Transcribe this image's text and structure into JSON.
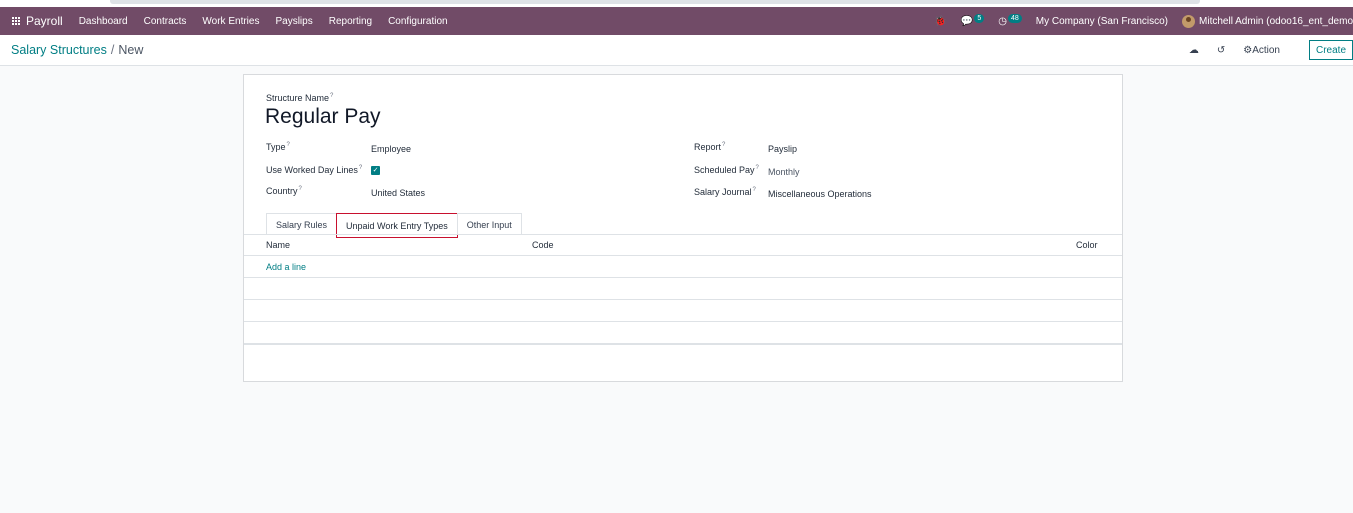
{
  "navbar": {
    "app_name": "Payroll",
    "menu": [
      "Dashboard",
      "Contracts",
      "Work Entries",
      "Payslips",
      "Reporting",
      "Configuration"
    ],
    "messages_count": "5",
    "activities_count": "48",
    "company": "My Company (San Francisco)",
    "user": "Mitchell Admin (odoo16_ent_demo"
  },
  "control": {
    "breadcrumb_parent": "Salary Structures",
    "breadcrumb_sep": "/",
    "breadcrumb_current": "New",
    "action_label": "Action",
    "create_label": "Create"
  },
  "form": {
    "structure_name_label": "Structure Name",
    "structure_name": "Regular Pay",
    "type_label": "Type",
    "type_value": "Employee",
    "use_worked_day_lines_label": "Use Worked Day Lines",
    "use_worked_day_lines_checked": true,
    "country_label": "Country",
    "country_value": "United States",
    "report_label": "Report",
    "report_value": "Payslip",
    "scheduled_pay_label": "Scheduled Pay",
    "scheduled_pay_value": "Monthly",
    "salary_journal_label": "Salary Journal",
    "salary_journal_value": "Miscellaneous Operations",
    "help_marker": "?"
  },
  "tabs": [
    "Salary Rules",
    "Unpaid Work Entry Types",
    "Other Input"
  ],
  "active_tab": "Unpaid Work Entry Types",
  "table": {
    "columns": [
      "Name",
      "Code",
      "Color"
    ],
    "add_line": "Add a line"
  },
  "colors": {
    "navbar": "#714b67",
    "accent": "#017e84",
    "highlight": "#c8102e"
  }
}
